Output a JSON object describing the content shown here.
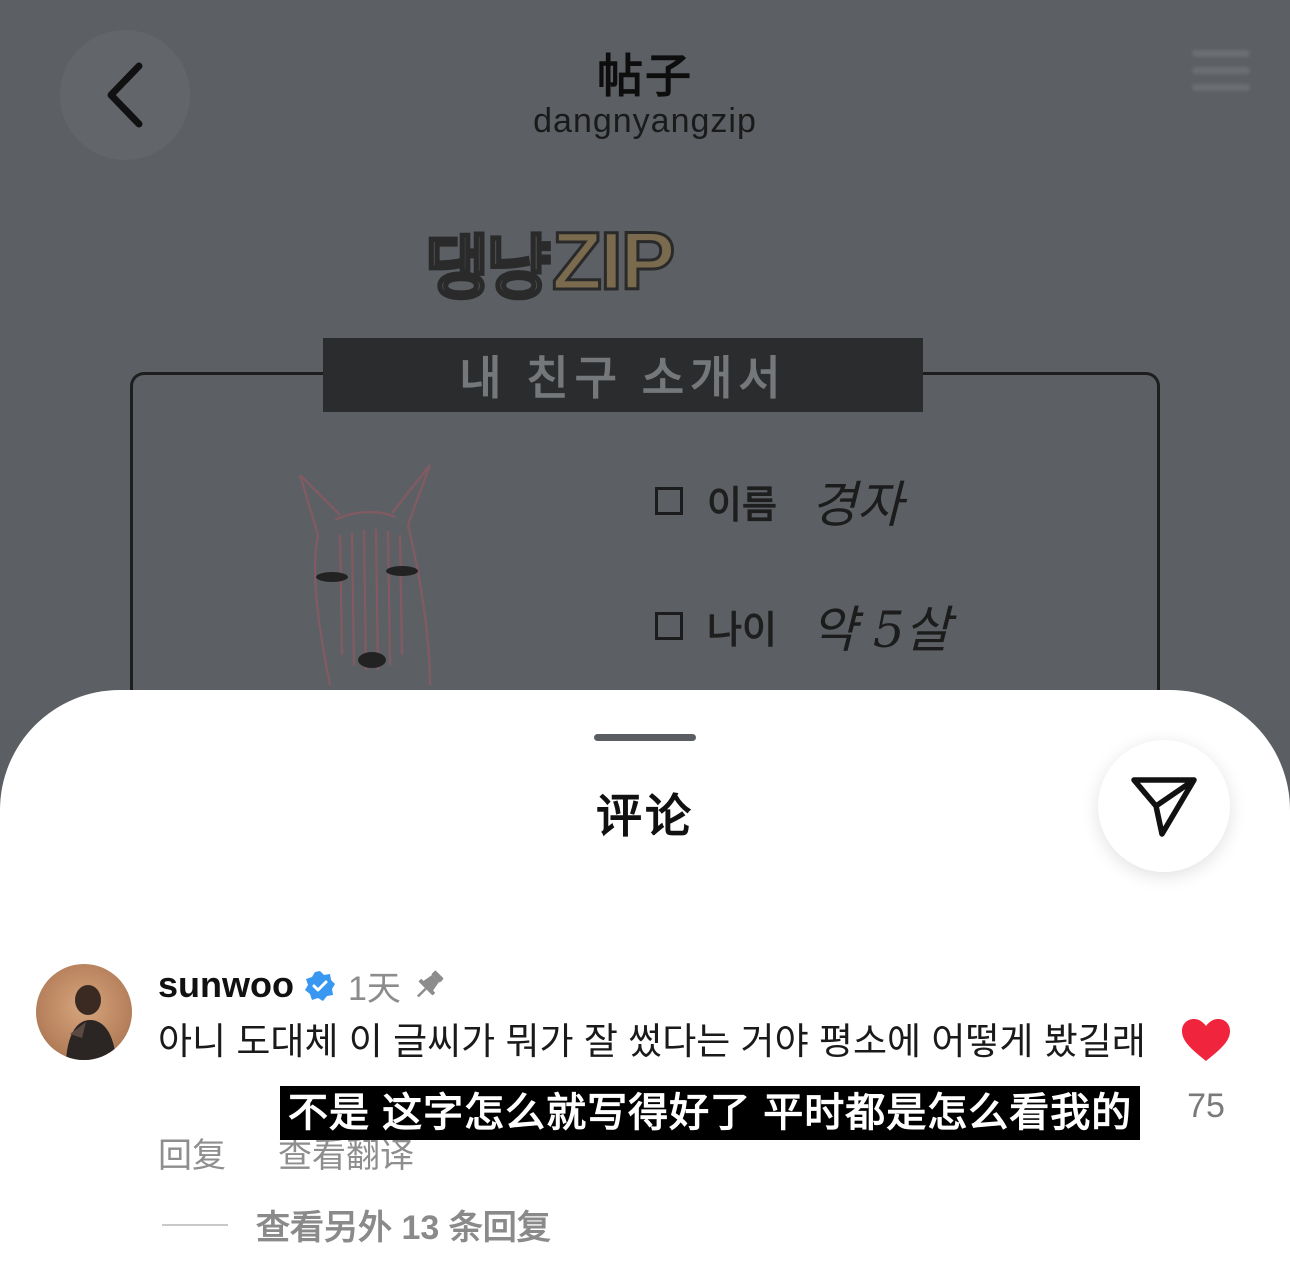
{
  "header": {
    "title": "帖子",
    "subtitle": "dangnyangzip"
  },
  "post": {
    "logo_korean": "댕냥",
    "logo_latin": "ZIP",
    "form_title": "내 친구 소개서",
    "fields": [
      {
        "label": "이름",
        "value": "경자"
      },
      {
        "label": "나이",
        "value": "약 5살"
      }
    ]
  },
  "sheet": {
    "title": "评论"
  },
  "comment": {
    "username": "sunwoo",
    "time": "1天",
    "text": "아니 도대체 이 글씨가 뭐가 잘 썼다는 거야 평소에 어떻게 봤길래",
    "subtitle": "不是 这字怎么就写得好了 平时都是怎么看我的",
    "reply_label": "回复",
    "translate_label": "查看翻译",
    "like_count": "75",
    "liked": true,
    "more_replies": "查看另外 13 条回复"
  },
  "colors": {
    "like": "#f0243c",
    "verified": "#3897f0",
    "dim_overlay": "#5c6064"
  }
}
